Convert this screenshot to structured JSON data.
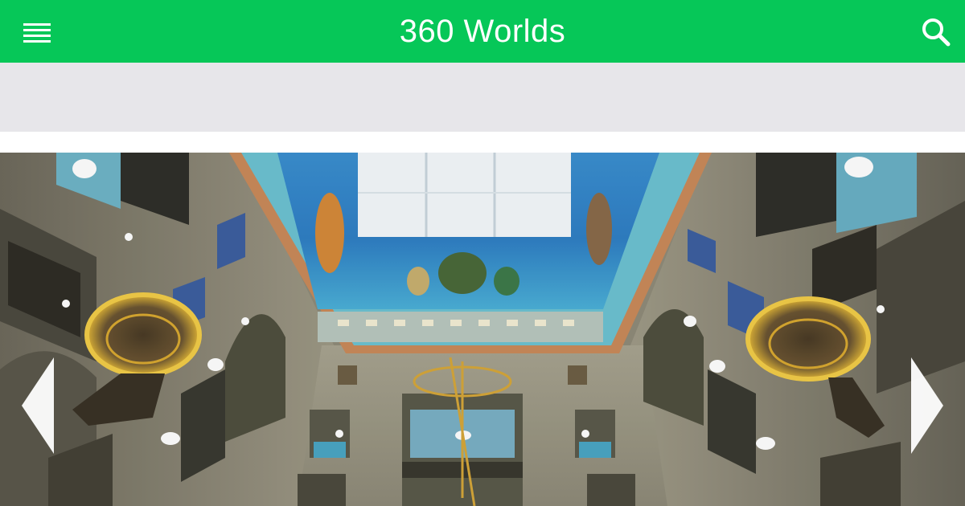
{
  "header": {
    "title": "360 Worlds",
    "menu_icon": "hamburger-menu-icon",
    "search_icon": "search-icon",
    "background_color": "#06c758",
    "title_color": "#ffffff"
  },
  "banner": {
    "background_color": "#e7e6ea"
  },
  "panorama": {
    "prev_icon": "chevron-left-icon",
    "next_icon": "chevron-right-icon"
  }
}
